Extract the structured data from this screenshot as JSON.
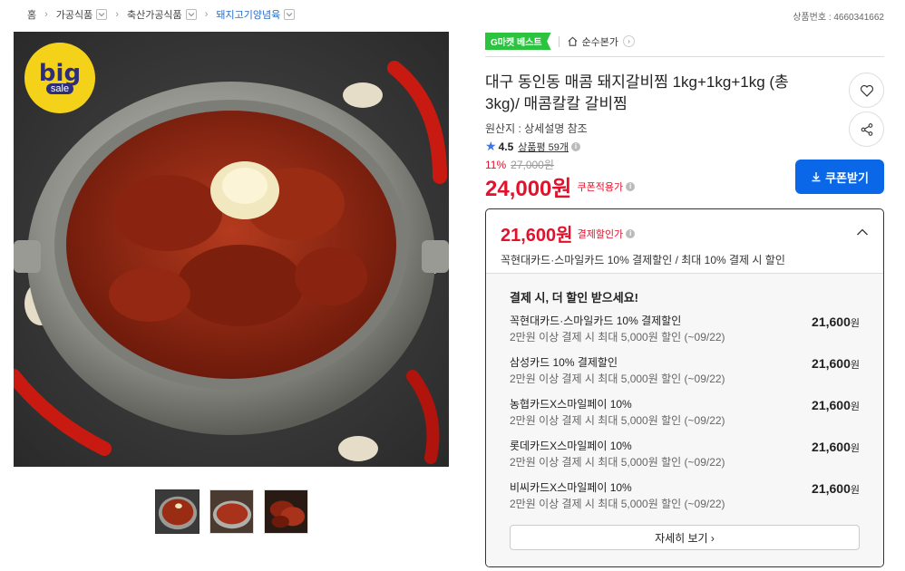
{
  "breadcrumb": {
    "items": [
      {
        "label": "홈"
      },
      {
        "label": "가공식품"
      },
      {
        "label": "축산가공식품"
      },
      {
        "label": "돼지고기양념육"
      }
    ],
    "separator": "›"
  },
  "product_no": "상품번호 : 4660341662",
  "image": {
    "badge_big": "big",
    "badge_sale": "sale",
    "thumbnail_count": 3
  },
  "badges": {
    "best": "G마켓 베스트",
    "store": "순수본가"
  },
  "product": {
    "title": "대구 동인동 매콤 돼지갈비찜 1kg+1kg+1kg (총 3kg)/ 매콤칼칼 갈비찜",
    "origin": "원산지 : 상세설명 참조",
    "rating": "4.5",
    "reviews": "상품평 59개",
    "discount_rate": "11%",
    "original_price": "27,000원",
    "price": "24,000원",
    "coupon_label": "쿠폰적용가",
    "coupon_button": "쿠폰받기"
  },
  "payment": {
    "price": "21,600원",
    "label": "결제할인가",
    "description": "꼭현대카드·스마일카드 10% 결제할인 / 최대 10% 결제 시 할인",
    "section_title": "결제 시, 더 할인 받으세요!",
    "cards": [
      {
        "name": "꼭현대카드·스마일카드 10% 결제할인",
        "sub": "2만원 이상 결제 시 최대 5,000원 할인 (~09/22)",
        "price": "21,600",
        "won": "원"
      },
      {
        "name": "삼성카드 10% 결제할인",
        "sub": "2만원 이상 결제 시 최대 5,000원 할인 (~09/22)",
        "price": "21,600",
        "won": "원"
      },
      {
        "name": "농협카드X스마일페이 10%",
        "sub": "2만원 이상 결제 시 최대 5,000원 할인 (~09/22)",
        "price": "21,600",
        "won": "원"
      },
      {
        "name": "롯데카드X스마일페이 10%",
        "sub": "2만원 이상 결제 시 최대 5,000원 할인 (~09/22)",
        "price": "21,600",
        "won": "원"
      },
      {
        "name": "비씨카드X스마일페이 10%",
        "sub": "2만원 이상 결제 시 최대 5,000원 할인 (~09/22)",
        "price": "21,600",
        "won": "원"
      }
    ],
    "more_button": "자세히 보기 ›"
  },
  "colors": {
    "price_red": "#e2112c",
    "accent_blue": "#0a68e8",
    "best_green": "#2cc33f"
  }
}
